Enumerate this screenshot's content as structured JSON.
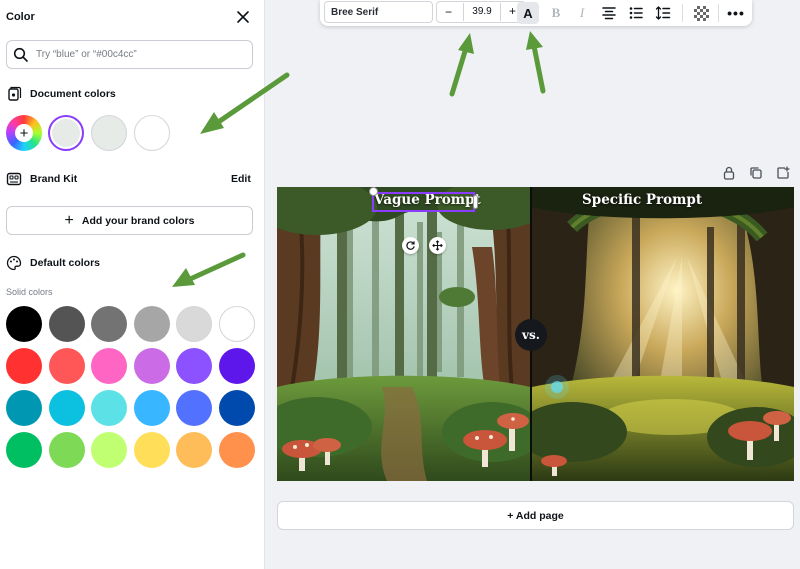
{
  "panel": {
    "title": "Color",
    "search_placeholder": "Try “blue” or “#00c4cc”",
    "document_colors": {
      "heading": "Document colors",
      "swatches": [
        "#e6ebe8",
        "#e6ebe8",
        "#ffffff"
      ],
      "selected_index": 0
    },
    "brand_kit": {
      "heading": "Brand Kit",
      "edit_label": "Edit",
      "add_button_label": "Add your brand colors"
    },
    "default_colors": {
      "heading": "Default colors",
      "solid_label": "Solid colors",
      "rows": [
        [
          "#000000",
          "#545454",
          "#737373",
          "#a6a6a6",
          "#d9d9d9",
          "#ffffff"
        ],
        [
          "#ff3131",
          "#ff5757",
          "#ff66c4",
          "#cb6ce6",
          "#8c52ff",
          "#5e17eb"
        ],
        [
          "#0097b2",
          "#0cc0df",
          "#5ce1e6",
          "#38b6ff",
          "#5271ff",
          "#004aad"
        ],
        [
          "#00bf63",
          "#7ed957",
          "#c1ff72",
          "#ffde59",
          "#ffbd59",
          "#ff914d"
        ]
      ]
    }
  },
  "toolbar": {
    "font_name": "Bree Serif",
    "font_size": "39.9",
    "minus_label": "−",
    "plus_label": "+",
    "text_color_label": "A",
    "bold_label": "B",
    "italic_label": "I",
    "more_label": "•••"
  },
  "canvas": {
    "left_title": "Vague Prompt",
    "right_title": "Specific Prompt",
    "vs_label": "vs."
  },
  "add_page_label": "+ Add page",
  "colors": {
    "accent": "#8b3dff",
    "arrow": "#5b9a3a"
  }
}
